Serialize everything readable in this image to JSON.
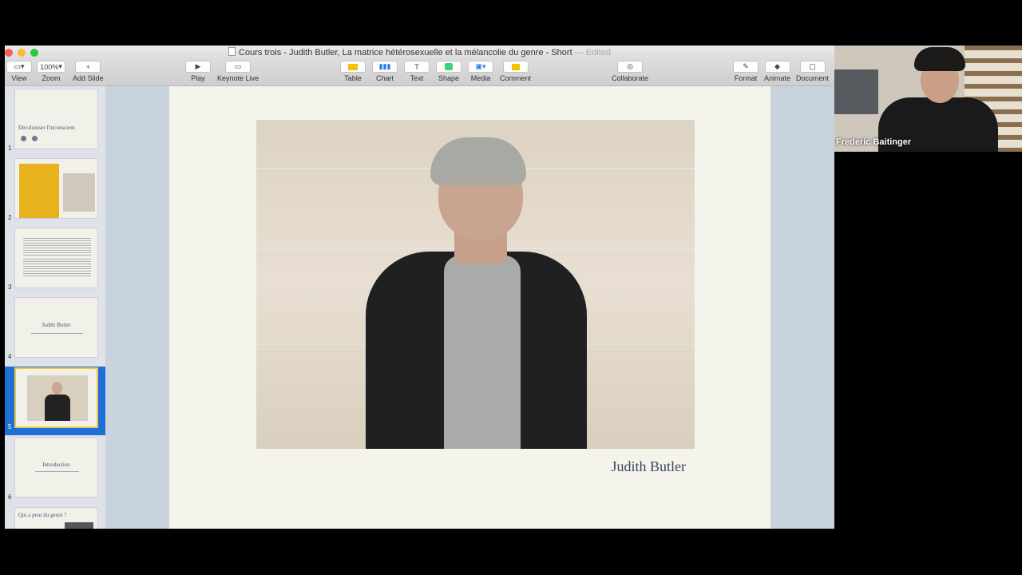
{
  "window": {
    "title": "Cours trois - Judith Butler, La matrice hétérosexuelle et la mélancolie du genre - Short",
    "status": "— Edited"
  },
  "toolbar": {
    "view": "View",
    "zoom_value": "100%",
    "zoom": "Zoom",
    "add_slide": "Add Slide",
    "play": "Play",
    "keynote_live": "Keynote Live",
    "table": "Table",
    "chart": "Chart",
    "text": "Text",
    "shape": "Shape",
    "media": "Media",
    "comment": "Comment",
    "collaborate": "Collaborate",
    "format": "Format",
    "animate": "Animate",
    "document": "Document"
  },
  "slides": [
    {
      "num": "1",
      "title": "Décoloniser l'inconscient"
    },
    {
      "num": "2",
      "title": ""
    },
    {
      "num": "3",
      "title": ""
    },
    {
      "num": "4",
      "title": "Judith Butler"
    },
    {
      "num": "5",
      "title": ""
    },
    {
      "num": "6",
      "title": "Introduction"
    },
    {
      "num": "",
      "title": "Qui a peur du genre ?"
    }
  ],
  "current_slide": {
    "caption": "Judith Butler"
  },
  "video": {
    "participant": "Frederic Baitinger"
  },
  "colors": {
    "selection": "#1f6fd6",
    "slide_bg": "#f4f4ec"
  }
}
